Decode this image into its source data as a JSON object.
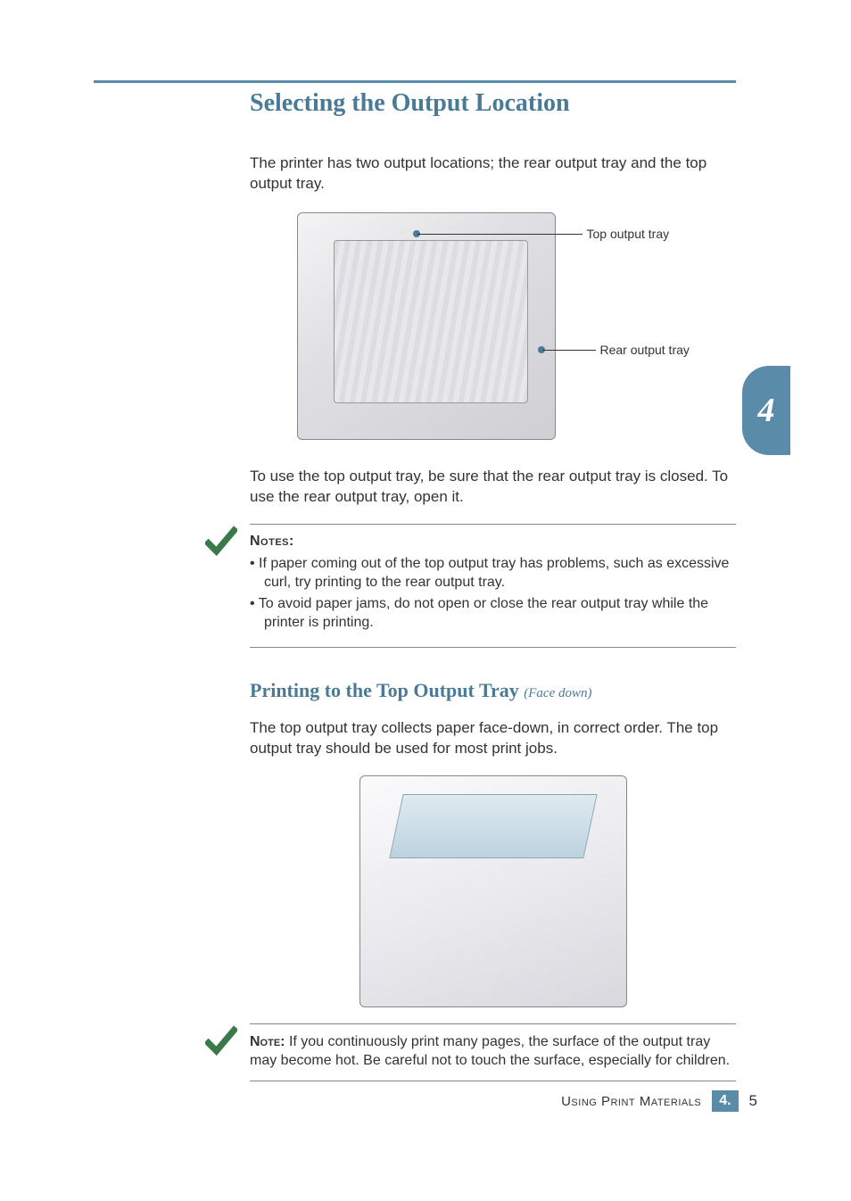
{
  "heading": "Selecting the Output Location",
  "intro": "The printer has two output locations; the rear output tray and the top output tray.",
  "figure1": {
    "callout_top": "Top output tray",
    "callout_rear": "Rear output tray"
  },
  "post_figure": "To use the top output tray, be sure that the rear output tray is closed. To use the rear output tray, open it.",
  "notes_heading": "Notes:",
  "notes": [
    "If paper coming out of the top output tray has problems, such as excessive curl, try printing to the rear output tray.",
    "To avoid paper jams, do not open or close the rear output tray while the printer is printing."
  ],
  "subheading": "Printing to the Top Output Tray",
  "subheading_suffix": "(Face down)",
  "subsection_body": "The top output tray collects paper face-down, in correct order. The top output tray should be used for most print jobs.",
  "note2_lead": "Note:",
  "note2_body": " If you continuously print many pages, the surface of the output tray may become hot. Be careful not to touch the surface, especially for children.",
  "chapter_number": "4",
  "footer": {
    "label": "Using Print Materials",
    "chapter": "4.",
    "page": "5"
  }
}
